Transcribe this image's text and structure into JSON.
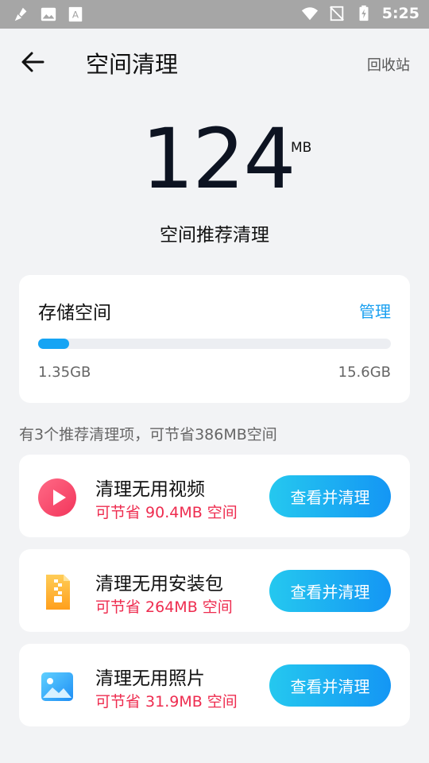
{
  "status_bar": {
    "time": "5:25",
    "icons": [
      "broom-icon",
      "image-icon",
      "text-icon",
      "wifi-icon",
      "signal-off-icon",
      "battery-charging-icon"
    ]
  },
  "header": {
    "title": "空间清理",
    "recycle_label": "回收站"
  },
  "hero": {
    "amount": "124",
    "unit": "MB",
    "subtitle": "空间推荐清理"
  },
  "storage": {
    "label": "存储空间",
    "manage_label": "管理",
    "used": "1.35GB",
    "total": "15.6GB",
    "used_fraction": 0.087,
    "accent_color": "#16a4f4"
  },
  "summary": "有3个推荐清理项，可节省386MB空间",
  "items": [
    {
      "name": "清理无用视频",
      "save_text": "可节省 90.4MB 空间",
      "button_label": "查看并清理",
      "icon": "video-play-icon"
    },
    {
      "name": "清理无用安装包",
      "save_text": "可节省 264MB 空间",
      "button_label": "查看并清理",
      "icon": "zip-package-icon"
    },
    {
      "name": "清理无用照片",
      "save_text": "可节省 31.9MB 空间",
      "button_label": "查看并清理",
      "icon": "photo-icon"
    }
  ],
  "colors": {
    "save_text": "#ee2c4f",
    "button_gradient_start": "#25c8ef",
    "button_gradient_end": "#1496f4",
    "background": "#f2f3f5"
  }
}
